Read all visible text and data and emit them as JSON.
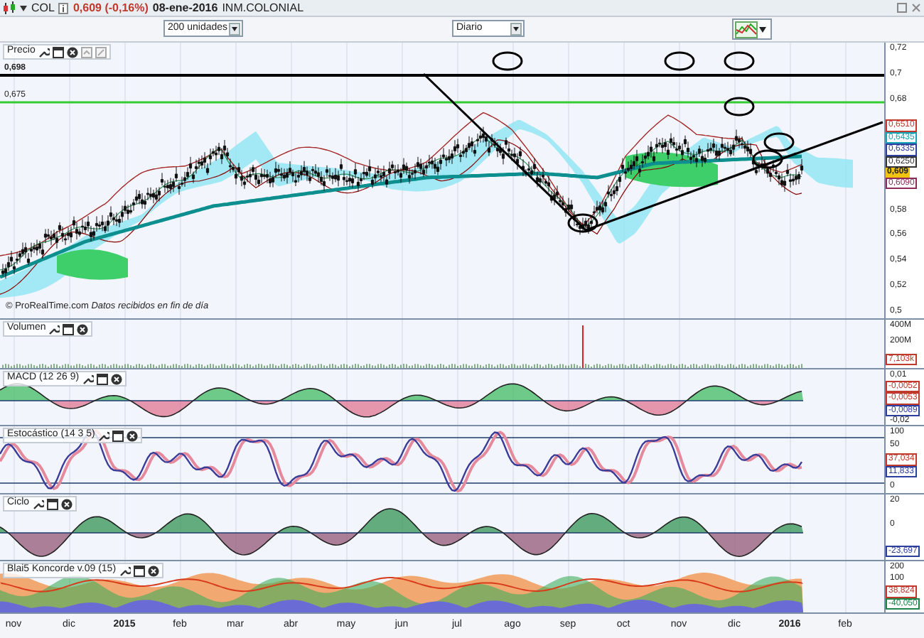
{
  "header": {
    "symbol": "COL",
    "quote": "0,609 (-0,16%)",
    "date": "08-ene-2016",
    "name": "INM.COLONIAL"
  },
  "toolbar": {
    "units": "200 unidades",
    "period": "Diario"
  },
  "panels": [
    {
      "kind": "price",
      "title": "Precio",
      "levels": [
        "0,698",
        "0,675"
      ],
      "credit": "© ProRealTime.com *Datos recibidos en fin de día*",
      "axis": [
        {
          "kind": "tick",
          "text": "0,72"
        },
        {
          "kind": "tick",
          "text": "0,7"
        },
        {
          "kind": "tick",
          "text": "0,68"
        },
        {
          "kind": "tag",
          "text": "0,6510",
          "color": "#c0392b"
        },
        {
          "kind": "tag",
          "text": "0,6435",
          "color": "#17a2b8"
        },
        {
          "kind": "tag",
          "text": "0,6335",
          "color": "#2c3e9e"
        },
        {
          "kind": "tag",
          "text": "0,6250",
          "color": "#333333"
        },
        {
          "kind": "current",
          "text": "0,609",
          "color": "#f1c40f"
        },
        {
          "kind": "tag",
          "text": "0,6090",
          "color": "#8e2b5a"
        },
        {
          "kind": "tick",
          "text": "0,58"
        },
        {
          "kind": "tick",
          "text": "0,56"
        },
        {
          "kind": "tick",
          "text": "0,54"
        },
        {
          "kind": "tick",
          "text": "0,52"
        },
        {
          "kind": "tick",
          "text": "0,5"
        }
      ]
    },
    {
      "kind": "volume",
      "title": "Volumen",
      "axis": [
        {
          "kind": "tick",
          "text": "400M"
        },
        {
          "kind": "tick",
          "text": "200M"
        },
        {
          "kind": "tag",
          "text": "7,103k",
          "color": "#c0392b"
        }
      ]
    },
    {
      "kind": "macd",
      "title": "MACD (12 26 9)",
      "axis": [
        {
          "kind": "tick",
          "text": "0,01"
        },
        {
          "kind": "tag",
          "text": "-0,0052",
          "color": "#c0392b"
        },
        {
          "kind": "tag",
          "text": "-0,0053",
          "color": "#c0392b"
        },
        {
          "kind": "tag",
          "text": "-0,0089",
          "color": "#2c3e9e"
        },
        {
          "kind": "tick",
          "text": "-0,02"
        }
      ]
    },
    {
      "kind": "stochastic",
      "title": "Estocástico (14 3 5)",
      "axis": [
        {
          "kind": "tick",
          "text": "100"
        },
        {
          "kind": "tick",
          "text": "50"
        },
        {
          "kind": "tag",
          "text": "37,034",
          "color": "#c0392b"
        },
        {
          "kind": "tag",
          "text": "11,833",
          "color": "#2c3e9e"
        },
        {
          "kind": "tick",
          "text": "0"
        }
      ]
    },
    {
      "kind": "cycle",
      "title": "Ciclo",
      "axis": [
        {
          "kind": "tick",
          "text": "20"
        },
        {
          "kind": "tick",
          "text": "0"
        },
        {
          "kind": "tag",
          "text": "-23,697",
          "color": "#2c3e9e"
        }
      ]
    },
    {
      "kind": "koncorde",
      "title": "Blai5 Koncorde v.09 (15)",
      "axis": [
        {
          "kind": "tick",
          "text": "200"
        },
        {
          "kind": "tick",
          "text": "100"
        },
        {
          "kind": "tag",
          "text": "38,824",
          "color": "#c0392b"
        },
        {
          "kind": "tag",
          "text": "-40,050",
          "color": "#1e8449"
        }
      ]
    }
  ],
  "x_axis": [
    {
      "text": "nov",
      "bold": false
    },
    {
      "text": "dic",
      "bold": false
    },
    {
      "text": "2015",
      "bold": true
    },
    {
      "text": "feb",
      "bold": false
    },
    {
      "text": "mar",
      "bold": false
    },
    {
      "text": "abr",
      "bold": false
    },
    {
      "text": "may",
      "bold": false
    },
    {
      "text": "jun",
      "bold": false
    },
    {
      "text": "jul",
      "bold": false
    },
    {
      "text": "ago",
      "bold": false
    },
    {
      "text": "sep",
      "bold": false
    },
    {
      "text": "oct",
      "bold": false
    },
    {
      "text": "nov",
      "bold": false
    },
    {
      "text": "dic",
      "bold": false
    },
    {
      "text": "2016",
      "bold": true
    },
    {
      "text": "feb",
      "bold": false
    }
  ]
}
